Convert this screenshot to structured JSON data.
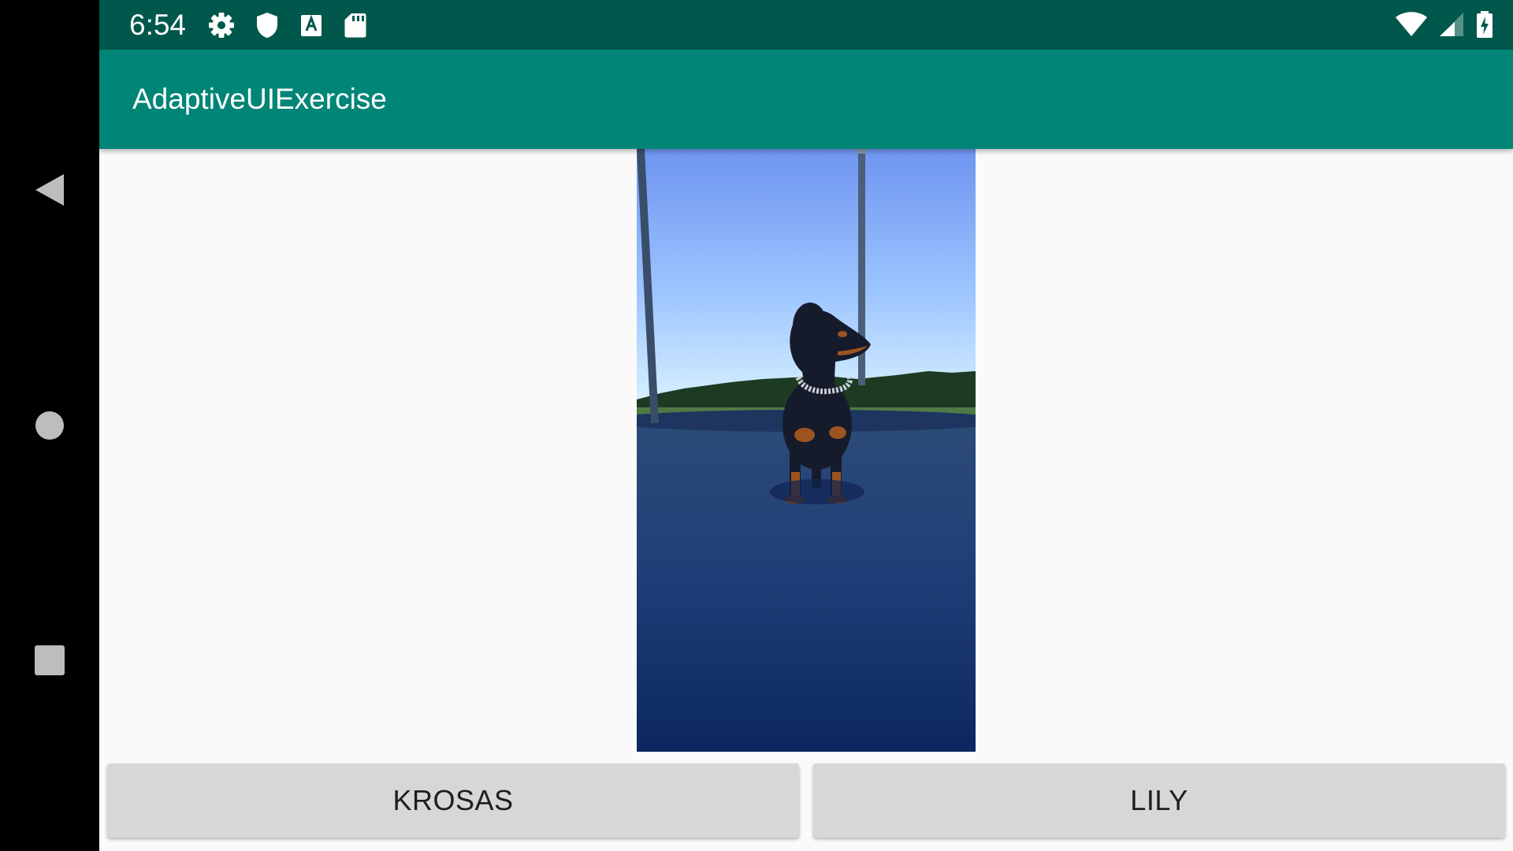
{
  "status_bar": {
    "time": "6:54",
    "left_icons": [
      "gear-icon",
      "shield-icon",
      "keyboard-a-icon",
      "sd-card-icon"
    ],
    "right_icons": [
      "wifi-icon",
      "cellular-signal-icon",
      "battery-charging-icon"
    ],
    "background": "#00574b"
  },
  "app_bar": {
    "title": "AdaptiveUIExercise",
    "background": "#008577"
  },
  "nav_bar": {
    "buttons": [
      "back-icon",
      "home-icon",
      "recents-icon"
    ]
  },
  "main": {
    "image": {
      "description_icon": "dog-photo",
      "subject": "dachshund"
    },
    "buttons": [
      {
        "label": "KROSAS"
      },
      {
        "label": "LILY"
      }
    ]
  }
}
